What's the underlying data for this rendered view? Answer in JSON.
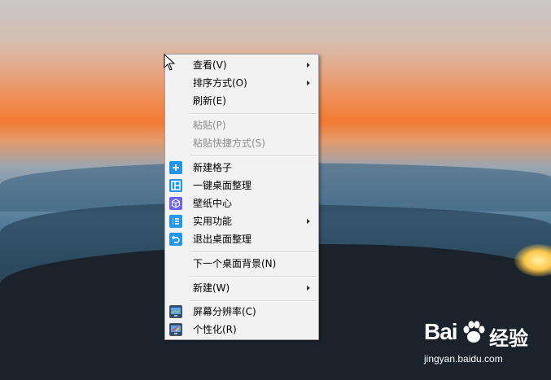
{
  "menu": {
    "items": [
      {
        "label": "查看(V)",
        "submenu": true,
        "enabled": true
      },
      {
        "label": "排序方式(O)",
        "submenu": true,
        "enabled": true
      },
      {
        "label": "刷新(E)",
        "submenu": false,
        "enabled": true
      },
      {
        "label": "粘贴(P)",
        "submenu": false,
        "enabled": false
      },
      {
        "label": "粘贴快捷方式(S)",
        "submenu": false,
        "enabled": false
      },
      {
        "label": "新建格子",
        "submenu": false,
        "enabled": true,
        "icon": "plus-icon"
      },
      {
        "label": "一键桌面整理",
        "submenu": false,
        "enabled": true,
        "icon": "layout-icon"
      },
      {
        "label": "壁纸中心",
        "submenu": false,
        "enabled": true,
        "icon": "cube-icon"
      },
      {
        "label": "实用功能",
        "submenu": true,
        "enabled": true,
        "icon": "list-icon"
      },
      {
        "label": "退出桌面整理",
        "submenu": false,
        "enabled": true,
        "icon": "undo-icon"
      },
      {
        "label": "下一个桌面背景(N)",
        "submenu": false,
        "enabled": true
      },
      {
        "label": "新建(W)",
        "submenu": true,
        "enabled": true
      },
      {
        "label": "屏幕分辨率(C)",
        "submenu": false,
        "enabled": true,
        "icon": "monitor-icon"
      },
      {
        "label": "个性化(R)",
        "submenu": false,
        "enabled": true,
        "icon": "personalize-icon"
      }
    ]
  },
  "watermark": {
    "logo_text": "Bai",
    "brand_cn": "经验",
    "url": "jingyan.baidu.com"
  },
  "colors": {
    "menu_bg": "#f2f2f2",
    "icon_blue": "#2196f3",
    "icon_purple": "#6a62f0",
    "disabled_text": "#8c8c8c"
  }
}
